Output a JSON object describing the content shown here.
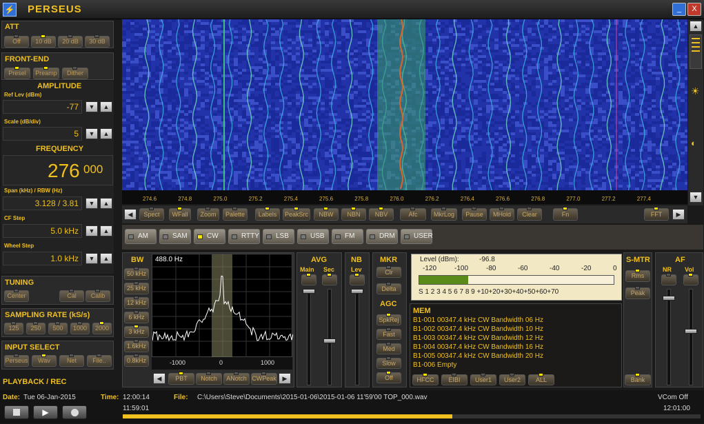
{
  "titlebar": {
    "title": "PERSEUS",
    "app_icon": "lightning-icon",
    "minimize": "_",
    "maximize": "□",
    "close": "X",
    "accent": "#f0c020"
  },
  "att": {
    "title": "ATT",
    "buttons": [
      "Off",
      "10 dB",
      "20 dB",
      "30 dB"
    ],
    "active": 1
  },
  "frontend": {
    "title": "FRONT-END",
    "buttons": [
      "Presel",
      "Preamp",
      "Dither"
    ],
    "active": [
      0,
      1
    ]
  },
  "amplitude": {
    "title": "AMPLITUDE",
    "reflev_label": "Ref Lev (dBm)",
    "reflev_value": "-77",
    "scale_label": "Scale (dB/div)",
    "scale_value": "5"
  },
  "frequency": {
    "title": "FREQUENCY",
    "main": "276",
    "sub": "000",
    "span_label": "Span (kHz) / RBW (Hz)",
    "span_value": "3.128 / 3.81",
    "cfstep_label": "CF Step",
    "cfstep_value": "5.0 kHz",
    "wheel_label": "Wheel Step",
    "wheel_value": "1.0 kHz"
  },
  "tuning": {
    "title": "TUNING",
    "buttons": [
      "Center",
      "Cal",
      "Calib"
    ]
  },
  "sampling": {
    "title": "SAMPLING RATE (kS/s)",
    "buttons": [
      "125",
      "250",
      "500",
      "1000",
      "2000"
    ],
    "active": 4
  },
  "input": {
    "title": "INPUT SELECT",
    "buttons": [
      "Perseus",
      "Wav",
      "Net",
      "File.."
    ],
    "active": 1
  },
  "playback": {
    "title": "PLAYBACK / REC"
  },
  "freq_axis": {
    "ticks": [
      "274.6",
      "274.8",
      "275.0",
      "275.2",
      "275.4",
      "275.6",
      "275.8",
      "276.0",
      "276.2",
      "276.4",
      "276.6",
      "276.8",
      "277.0",
      "277.2",
      "277.4"
    ]
  },
  "toolbar": {
    "buttons": [
      "Spect",
      "WFall",
      "Zoom",
      "Palette",
      "Labels",
      "PeakSrc",
      "NBW",
      "NBN",
      "NBV",
      "Afc",
      "MkrLog",
      "Pause",
      "MHold",
      "Clear",
      "Fn",
      "FFT"
    ],
    "left_arrow": "◀",
    "right_arrow": "▶"
  },
  "modes": {
    "items": [
      "AM",
      "SAM",
      "CW",
      "RTTY",
      "LSB",
      "USB",
      "FM",
      "DRM",
      "USER"
    ],
    "active": 2
  },
  "bw": {
    "title": "BW",
    "buttons": [
      "50 kHz",
      "25 kHz",
      "12 kHz",
      "6 kHz",
      "3 kHz",
      "1.6kHz",
      "0.8kHz"
    ],
    "active": 4,
    "readout": "488.0 Hz",
    "xticks": [
      "-1000",
      "0",
      "1000"
    ]
  },
  "filter_buttons": {
    "items": [
      "PBT",
      "Notch",
      "ANotch",
      "CWPeak"
    ],
    "left": "◀",
    "right": "▶"
  },
  "avg": {
    "title": "AVG",
    "main": "Main",
    "sec": "Sec"
  },
  "nb": {
    "title": "NB",
    "lev": "Lev"
  },
  "mkr": {
    "title": "MKR",
    "buttons": [
      "Clr",
      "Delta"
    ]
  },
  "agc": {
    "title": "AGC",
    "buttons": [
      "SpkRej",
      "Fast",
      "Med",
      "Slow",
      "Off"
    ]
  },
  "smeter": {
    "level_label": "Level (dBm):",
    "level_value": "-96.8",
    "dbm_scale": [
      "-120",
      "-100",
      "-80",
      "-60",
      "-40",
      "-20",
      "0"
    ],
    "s_scale": "1  3  5  7  9  +10 +20 +30 +40 +50 +60 +70",
    "s_scale_full": "S 1 2 3 4 5 6 7 8 9 +10+20+30+40+50+60+70",
    "fill": 0.25
  },
  "smtr": {
    "title": "S-MTR",
    "buttons": [
      "Rms",
      "Peak"
    ]
  },
  "af": {
    "title": "AF",
    "nr": "NR",
    "vol": "Vol"
  },
  "mem": {
    "title": "MEM",
    "lines": [
      "B1-001 00347.4 kHz  CW  Bandwidth 06 Hz",
      "B1-002 00347.4 kHz  CW  Bandwidth 10 Hz",
      "B1-003 00347.4 kHz  CW  Bandwidth 12 Hz",
      "B1-004 00347.4 kHz  CW  Bandwidth 16 Hz",
      "B1-005 00347.4 kHz  CW  Bandwidth 20 Hz",
      "B1-006 Empty"
    ],
    "buttons": [
      "HFCC",
      "EIBI",
      "User1",
      "User2",
      "ALL"
    ],
    "bank": "Bank"
  },
  "status": {
    "date_label": "Date:",
    "date_value": "Tue 06-Jan-2015",
    "time_label": "Time:",
    "time_value": "12:00:14",
    "file_label": "File:",
    "file_value": "C:\\Users\\Steve\\Documents\\2015-01-06\\2015-01-06 11'59'00 TOP_000.wav",
    "vcom": "VCom Off",
    "start_time": "11:59:01",
    "end_time": "12:01:00",
    "progress": 0.57
  },
  "transport": [
    "stop-icon",
    "play-icon",
    "record-icon"
  ]
}
